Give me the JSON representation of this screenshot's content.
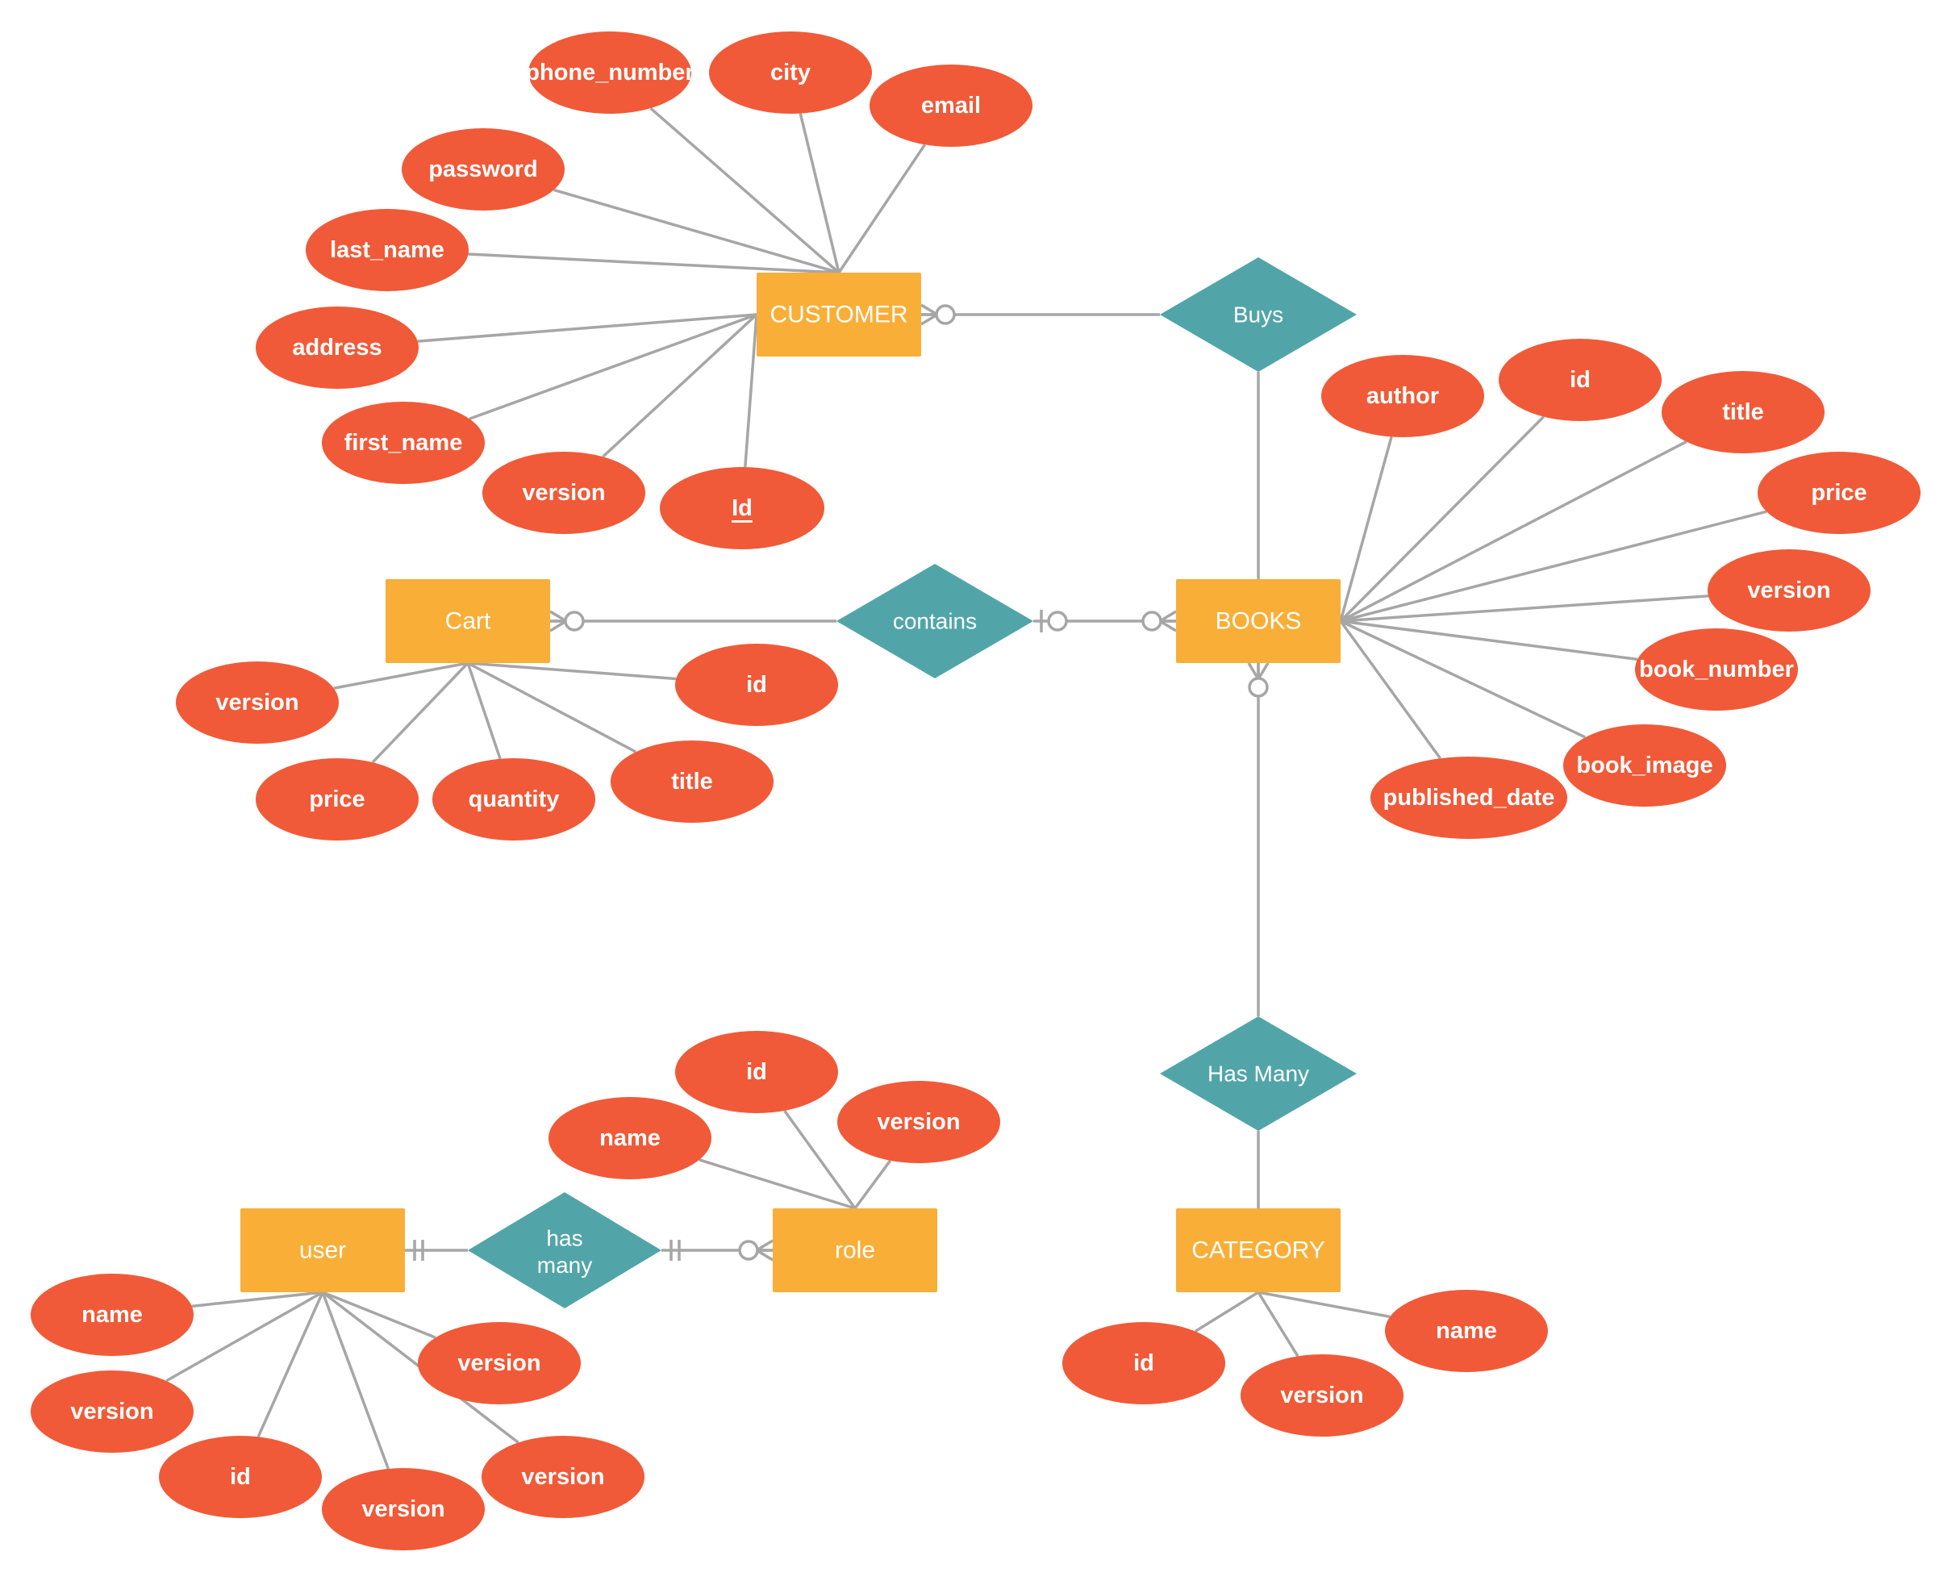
{
  "colors": {
    "entity": "#f9ae38",
    "relationship": "#51a5a8",
    "attribute": "#f05a38",
    "line": "#a6a6a6",
    "text": "#ffffff"
  },
  "entities": [
    {
      "id": "customer",
      "label": "CUSTOMER"
    },
    {
      "id": "books",
      "label": "BOOKS"
    },
    {
      "id": "cart",
      "label": "Cart"
    },
    {
      "id": "category",
      "label": "CATEGORY"
    },
    {
      "id": "user",
      "label": "user"
    },
    {
      "id": "role",
      "label": "role"
    }
  ],
  "relationships": [
    {
      "id": "buys",
      "label": "Buys"
    },
    {
      "id": "contains",
      "label": "contains"
    },
    {
      "id": "has_many_cat",
      "label": "Has Many"
    },
    {
      "id": "has_many_role",
      "label": "has many"
    }
  ],
  "attributes": {
    "customer": [
      {
        "label": "phone_number"
      },
      {
        "label": "city"
      },
      {
        "label": "email"
      },
      {
        "label": "password"
      },
      {
        "label": "last_name"
      },
      {
        "label": "address"
      },
      {
        "label": "first_name"
      },
      {
        "label": "version"
      },
      {
        "label": "Id",
        "key": true
      }
    ],
    "books": [
      {
        "label": "author"
      },
      {
        "label": "id"
      },
      {
        "label": "title"
      },
      {
        "label": "price"
      },
      {
        "label": "version"
      },
      {
        "label": "book_number"
      },
      {
        "label": "book_image"
      },
      {
        "label": "published_date"
      }
    ],
    "cart": [
      {
        "label": "version"
      },
      {
        "label": "id"
      },
      {
        "label": "price"
      },
      {
        "label": "quantity"
      },
      {
        "label": "title"
      }
    ],
    "role": [
      {
        "label": "name"
      },
      {
        "label": "id"
      },
      {
        "label": "version"
      }
    ],
    "user": [
      {
        "label": "name"
      },
      {
        "label": "version"
      },
      {
        "label": "id"
      },
      {
        "label": "version"
      },
      {
        "label": "version"
      },
      {
        "label": "version"
      }
    ],
    "category": [
      {
        "label": "id"
      },
      {
        "label": "version"
      },
      {
        "label": "name"
      }
    ]
  },
  "connections": [
    {
      "from": "customer",
      "to": "buys",
      "from_end": "zero-or-many",
      "to_end": "none"
    },
    {
      "from": "buys",
      "to": "books",
      "from_end": "none",
      "to_end": "none"
    },
    {
      "from": "cart",
      "to": "contains",
      "from_end": "zero-or-many",
      "to_end": "none"
    },
    {
      "from": "contains",
      "to": "books",
      "from_end": "zero-or-one",
      "to_end": "zero-or-many"
    },
    {
      "from": "books",
      "to": "has_many_cat",
      "from_end": "zero-or-many",
      "to_end": "none"
    },
    {
      "from": "has_many_cat",
      "to": "category",
      "from_end": "none",
      "to_end": "none"
    },
    {
      "from": "user",
      "to": "has_many_role",
      "from_end": "exactly-one",
      "to_end": "none"
    },
    {
      "from": "has_many_role",
      "to": "role",
      "from_end": "exactly-one",
      "to_end": "zero-or-many"
    }
  ]
}
